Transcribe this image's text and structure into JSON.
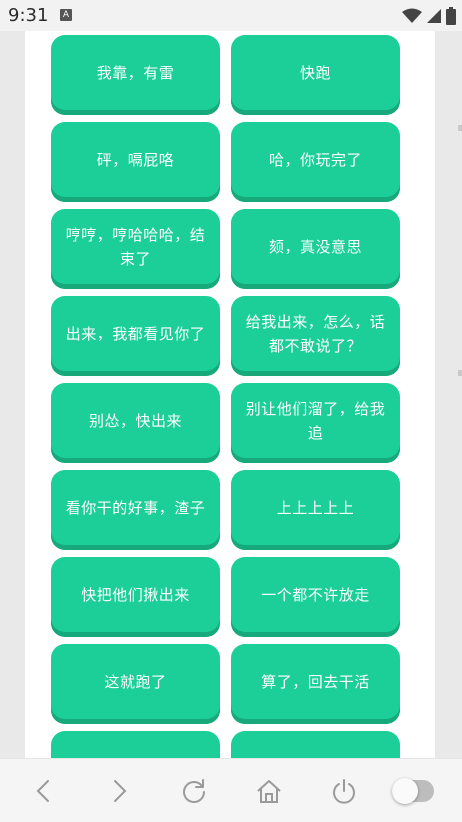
{
  "status_bar": {
    "time": "9:31",
    "notification_badge": "A"
  },
  "buttons": [
    "我靠，有雷",
    "快跑",
    "砰，嗝屁咯",
    "哈，你玩完了",
    "哼哼，哼哈哈哈，结束了",
    "颏，真没意思",
    "出来，我都看见你了",
    "给我出来，怎么，话都不敢说了？",
    "别怂，快出来",
    "别让他们溜了，给我追",
    "看你干的好事，渣子",
    "上上上上上",
    "快把他们揪出来",
    "一个都不许放走",
    "这就跑了",
    "算了，回去干活",
    "",
    ""
  ],
  "colors": {
    "button": "#1ccf98",
    "button_shadow": "#17a87b"
  },
  "bottom_bar": {
    "back_icon": "chevron-left-icon",
    "forward_icon": "chevron-right-icon",
    "refresh_icon": "refresh-icon",
    "home_icon": "home-icon",
    "power_icon": "power-icon",
    "toggle_state": "off"
  }
}
